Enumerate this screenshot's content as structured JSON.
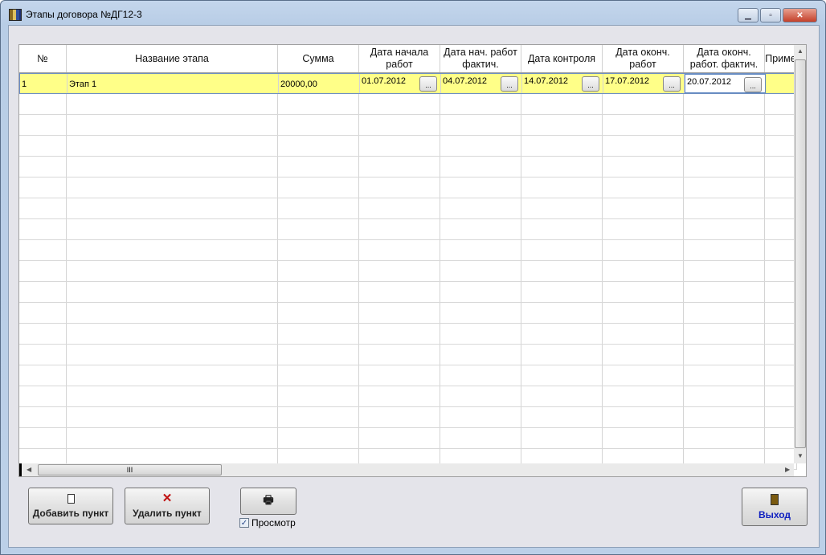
{
  "window": {
    "title": "Этапы договора №ДГ12-3"
  },
  "grid": {
    "columns": [
      "№",
      "Название этапа",
      "Сумма",
      "Дата начала\nработ",
      "Дата нач. работ\nфактич.",
      "Дата контроля",
      "Дата оконч.\nработ",
      "Дата оконч.\nработ. фактич.",
      "Приме"
    ],
    "rows": [
      {
        "num": "1",
        "name": "Этап 1",
        "sum": "20000,00",
        "start": "01.07.2012",
        "start_fact": "04.07.2012",
        "control": "14.07.2012",
        "end": "17.07.2012",
        "end_fact": "20.07.2012",
        "note": ""
      }
    ],
    "picker_label": "..."
  },
  "buttons": {
    "add": "Добавить пункт",
    "delete": "Удалить пункт",
    "exit": "Выход"
  },
  "preview": {
    "label": "Просмотр",
    "checked": true
  }
}
